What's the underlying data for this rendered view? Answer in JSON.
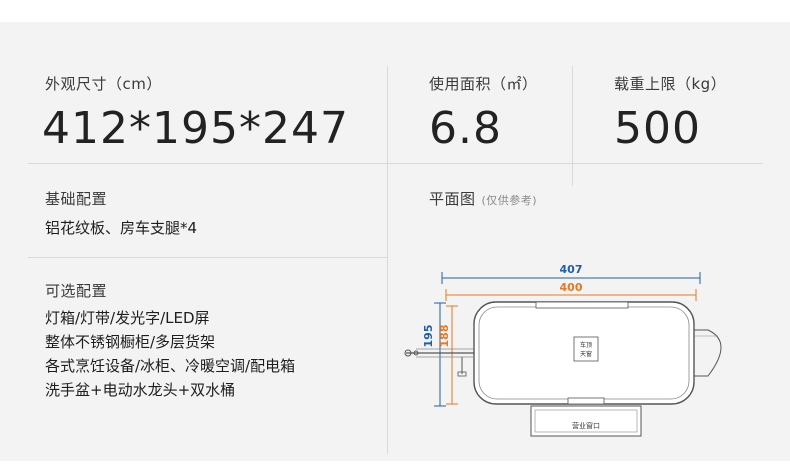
{
  "dimensions": {
    "label": "外观尺寸（cm）",
    "value": "412*195*247"
  },
  "usable_area": {
    "label": "使用面积（㎡）",
    "value": "6.8"
  },
  "load_limit": {
    "label": "载重上限（kg）",
    "value": "500"
  },
  "basic_config": {
    "label": "基础配置",
    "text": "铝花纹板、房车支腿*4"
  },
  "optional_config": {
    "label": "可选配置",
    "items": [
      "灯箱/灯带/发光字/LED屏",
      "整体不锈钢橱柜/多层货架",
      "各式烹饪设备/冰柜、冷暖空调/配电箱",
      "洗手盆+电动水龙头+双水桶"
    ]
  },
  "floor_plan": {
    "label": "平面图",
    "note": "(仅供参考)",
    "dim_outer_length": "407",
    "dim_inner_length": "400",
    "dim_outer_width": "195",
    "dim_inner_width": "188",
    "sign_line1": "车顶",
    "sign_line2": "天窗",
    "window_label": "营业窗口",
    "colors": {
      "outer_dim": "#1f5fa8",
      "inner_dim": "#e87722",
      "line": "#555555"
    }
  }
}
